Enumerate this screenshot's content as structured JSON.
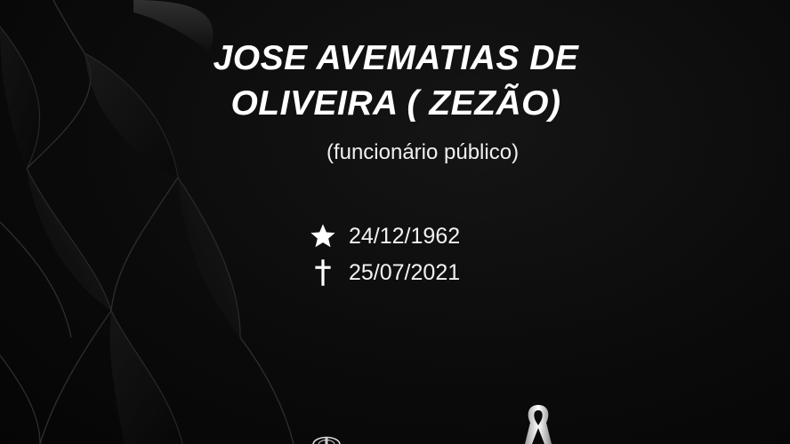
{
  "memorial": {
    "name_line1": "JOSE AVEMATIAS DE",
    "name_line2": "OLIVEIRA ( ZEZÃO)",
    "occupation": "(funcionário público)",
    "birth_date": "24/12/1962",
    "death_date": "25/07/2021"
  },
  "icons": {
    "birth": "star-icon",
    "death": "cross-icon",
    "mourning": "mourning-ribbon-icon"
  },
  "colors": {
    "background": "#0a0a0a",
    "text": "#ffffff"
  }
}
